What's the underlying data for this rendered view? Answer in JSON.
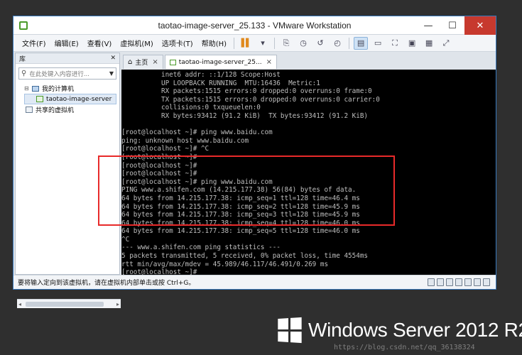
{
  "window": {
    "title": "taotao-image-server_25.133 - VMware Workstation",
    "controls": {
      "minimize": "—",
      "maximize": "☐",
      "close": "✕"
    }
  },
  "menubar": {
    "items": [
      "文件(F)",
      "编辑(E)",
      "查看(V)",
      "虚拟机(M)",
      "选项卡(T)",
      "帮助(H)"
    ]
  },
  "library": {
    "title": "库",
    "close": "✕",
    "search_placeholder": "在此处键入内容进行...",
    "tree": {
      "my_computer": "我的计算机",
      "vm": "taotao-image-server",
      "shared": "共享的虚拟机"
    }
  },
  "tabs": [
    {
      "label": "主页"
    },
    {
      "label": "taotao-image-server_25..."
    }
  ],
  "console": {
    "lines": [
      "          inet6 addr: ::1/128 Scope:Host",
      "          UP LOOPBACK RUNNING  MTU:16436  Metric:1",
      "          RX packets:1515 errors:0 dropped:0 overruns:0 frame:0",
      "          TX packets:1515 errors:0 dropped:0 overruns:0 carrier:0",
      "          collisions:0 txqueuelen:0",
      "          RX bytes:93412 (91.2 KiB)  TX bytes:93412 (91.2 KiB)",
      "",
      "[root@localhost ~]# ping www.baidu.com",
      "ping: unknown host www.baidu.com",
      "[root@localhost ~]# ^C",
      "[root@localhost ~]#",
      "[root@localhost ~]#",
      "[root@localhost ~]#",
      "[root@localhost ~]# ping www.baidu.com",
      "PING www.a.shifen.com (14.215.177.38) 56(84) bytes of data.",
      "64 bytes from 14.215.177.38: icmp_seq=1 ttl=128 time=46.4 ms",
      "64 bytes from 14.215.177.38: icmp_seq=2 ttl=128 time=45.9 ms",
      "64 bytes from 14.215.177.38: icmp_seq=3 ttl=128 time=45.9 ms",
      "64 bytes from 14.215.177.38: icmp_seq=4 ttl=128 time=46.0 ms",
      "64 bytes from 14.215.177.38: icmp_seq=5 ttl=128 time=46.0 ms",
      "^C",
      "--- www.a.shifen.com ping statistics ---",
      "5 packets transmitted, 5 received, 0% packet loss, time 4554ms",
      "rtt min/avg/max/mdev = 45.989/46.117/46.491/0.269 ms",
      "[root@localhost ~]# _"
    ]
  },
  "statusbar": {
    "text": "要将输入定向到该虚拟机，请在虚拟机内部单击或按 Ctrl+G。"
  },
  "desktop": {
    "brand": "Windows Server 2012 R2",
    "watermark": "https://blog.csdn.net/qq_36138324"
  },
  "colors": {
    "highlight_box": "#e82a2a",
    "console_bg": "#000000",
    "console_text": "#bfbfbf"
  }
}
